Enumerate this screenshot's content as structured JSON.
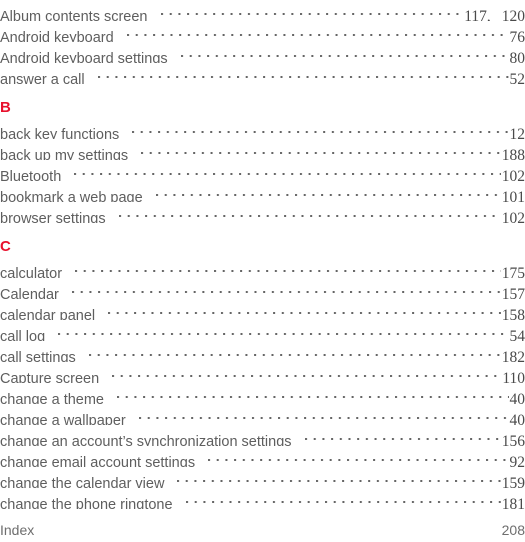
{
  "document": {
    "type": "index-page",
    "accent_color": "#e8112d",
    "text_color": "#5e5e5e"
  },
  "index": {
    "blocks": [
      {
        "kind": "entries",
        "entries": [
          {
            "label": "Album contents screen",
            "pages": "117,",
            "pages_extra": "120"
          },
          {
            "label": "Android keyboard",
            "pages": "76",
            "pages_extra": ""
          },
          {
            "label": "Android keyboard settings",
            "pages": "80",
            "pages_extra": ""
          },
          {
            "label": "answer a call",
            "pages": "52",
            "pages_extra": ""
          }
        ]
      },
      {
        "kind": "section",
        "letter": "B",
        "entries": [
          {
            "label": "back key functions",
            "pages": "12",
            "pages_extra": ""
          },
          {
            "label": "back up my settings",
            "pages": "188",
            "pages_extra": ""
          },
          {
            "label": "Bluetooth",
            "pages": "102",
            "pages_extra": ""
          },
          {
            "label": "bookmark a web page",
            "pages": "101",
            "pages_extra": ""
          },
          {
            "label": "browser settings",
            "pages": "102",
            "pages_extra": ""
          }
        ]
      },
      {
        "kind": "section",
        "letter": "C",
        "entries": [
          {
            "label": "calculator",
            "pages": "175",
            "pages_extra": ""
          },
          {
            "label": "Calendar",
            "pages": "157",
            "pages_extra": ""
          },
          {
            "label": "calendar panel",
            "pages": "158",
            "pages_extra": ""
          },
          {
            "label": "call log",
            "pages": "54",
            "pages_extra": ""
          },
          {
            "label": "call settings",
            "pages": "182",
            "pages_extra": ""
          },
          {
            "label": "Capture screen",
            "pages": "110",
            "pages_extra": ""
          },
          {
            "label": "change a theme",
            "pages": "40",
            "pages_extra": ""
          },
          {
            "label": "change a wallpaper",
            "pages": "40",
            "pages_extra": ""
          },
          {
            "label": "change an account’s synchronization settings",
            "pages": "156",
            "pages_extra": ""
          },
          {
            "label": "change email account settings",
            "pages": "92",
            "pages_extra": ""
          },
          {
            "label": "change the calendar view",
            "pages": "159",
            "pages_extra": ""
          },
          {
            "label": "change the phone ringtone",
            "pages": "181",
            "pages_extra": ""
          }
        ]
      }
    ]
  },
  "footer": {
    "label": "Index",
    "page_number": "208"
  }
}
